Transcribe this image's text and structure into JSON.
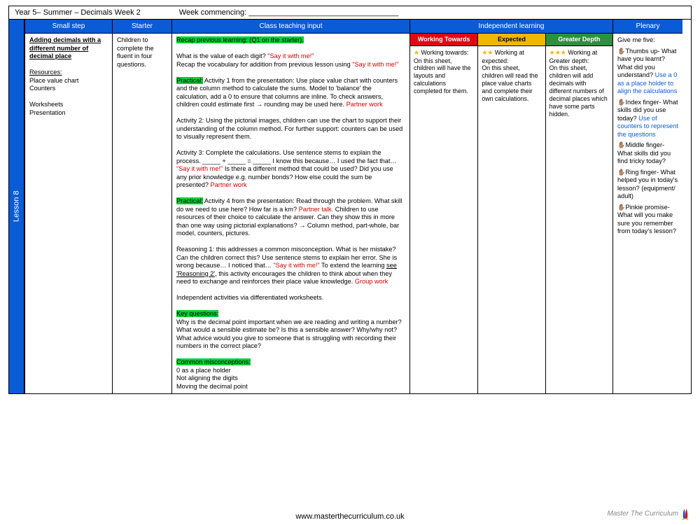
{
  "header": {
    "left": "Year 5– Summer – Decimals Week 2",
    "mid": "Week commencing: ___________________________________"
  },
  "lesson_label": "Lesson 8",
  "columns": {
    "c1": "Small step",
    "c2": "Starter",
    "c3": "Class teaching input",
    "c4": "Independent learning",
    "c5": "Plenary"
  },
  "smallstep": {
    "title": "Adding decimals with a different number of decimal place",
    "res_label": "Resources:",
    "res1": "Place value chart",
    "res2": "Counters",
    "res3": "Worksheets",
    "res4": "Presentation"
  },
  "starter": "Children to complete the fluent in four questions.",
  "teaching": {
    "recap": "Recap previous learning: (Q1 on the starter).",
    "t1a": "What is the value of each digit? ",
    "t1b": "\"Say it with me!\"",
    "t2a": "Recap the vocabulary for addition from previous lesson using ",
    "t2b": "\"Say it with me!\"",
    "practical1_label": "Practical:",
    "practical1": " Activity 1 from the presentation: Use place value chart with counters and the column method to calculate the sums. Model to 'balance' the calculation, add a 0 to ensure that columns are inline. To check answers, children could estimate first → rounding may be used here. ",
    "partner": "Partner work",
    "act2": "Activity 2: Using the pictorial images, children can use the chart to support their understanding of the column method. For further support: counters can be used to visually represent them.",
    "act3a": "Activity 3: Complete the calculations. Use sentence stems to explain the process. _____ + _____ = _____ I know this because… I used the fact that… ",
    "act3b": "\"Say it with me!\"",
    "act3c": "  Is there a different method that could be used? Did you use any prior knowledge e.g. number bonds? How else could the sum be presented? ",
    "practical2_label": "Practical:",
    "practical2a": " Activity 4 from the presentation: Read through the problem. What skill do we need to use here? How far is a km? ",
    "partner_talk": "Partner talk.",
    "practical2b": " Children to use resources of their choice  to calculate the answer. Can they show this in more than one way using pictorial explanations? → Column method, part-whole, bar model, counters, pictures.",
    "reason_a": "Reasoning 1: this addresses a common misconception. What is her mistake? Can the children correct this? Use sentence stems to explain her error. She is wrong because… I noticed that… ",
    "reason_say": "\"Say it with me!\"",
    "reason_b": " To extend the learning ",
    "reason_see": "see 'Reasoning 2',",
    "reason_c": " this activity encourages the children to think about when they need to exchange and reinforces their place value knowledge. ",
    "group": "Group work",
    "indep": "Independent activities via differentiated worksheets.",
    "keyq_label": "Key questions:",
    "keyq": "Why is the decimal point important when we are reading and writing a number? What would a sensible estimate be? Is this a sensible answer? Why/why not? What advice would you give to someone that is struggling with recording their numbers in the correct place?",
    "miscon_label": "Common misconceptions:",
    "miscon1": "0 as a place holder",
    "miscon2": "Not aligning the digits",
    "miscon3": "Moving the decimal point"
  },
  "independent": {
    "wt_head": "Working Towards",
    "ex_head": "Expected",
    "gd_head": "Greater Depth",
    "wt_intro": " Working towards:",
    "wt": "On this sheet, children will have the layouts and calculations completed for them.",
    "ex_intro": " Working at expected:",
    "ex": "On this sheet, children will read the place value charts and complete their own calculations.",
    "gd_intro": " Working at Greater depth:",
    "gd": "On this sheet, children will add decimals with different numbers of decimal places which have some parts hidden."
  },
  "plenary": {
    "title": "Give me five:",
    "p1a": "✋🏽Thumbs up- What have you learnt? What did you understand?",
    "p1b": "Use a 0 as a place holder to align the calculations",
    "p2a": "✋🏽Index finger- What skills did you use today?",
    "p2b": "Use of counters to represent the questions",
    "p3": "✋🏽Middle finger- What skills did you find tricky today?",
    "p4": "✋🏽Ring finger- What helped you in today's lesson? (equipment/ adult)",
    "p5": "✋🏽Pinkie promise- What will you make sure you remember from today's lesson?"
  },
  "footer": "www.masterthecurriculum.co.uk",
  "brand": "Master The Curriculum"
}
